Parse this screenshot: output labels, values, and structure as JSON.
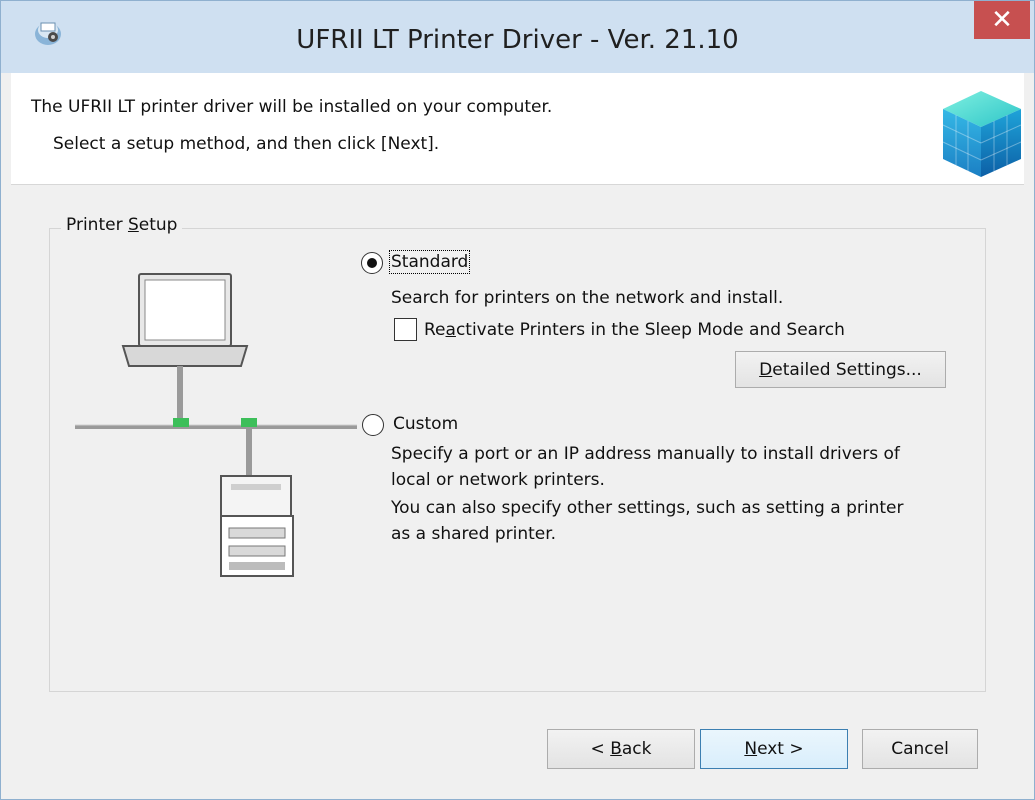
{
  "window": {
    "title": "UFRII LT Printer Driver - Ver. 21.10",
    "close_symbol": "✕",
    "app_icon": "printer-install-icon"
  },
  "header": {
    "line1": "The UFRII LT printer driver will be installed on your computer.",
    "line2": "Select a setup method, and then click [Next].",
    "graphic": "blue-cube-graphic"
  },
  "group": {
    "label_prefix": "Printer ",
    "label_accel": "S",
    "label_suffix": "etup"
  },
  "options": {
    "standard": {
      "label": "Standard",
      "accel": "S",
      "selected": true,
      "description": "Search for printers on the network and install.",
      "checkbox": {
        "label_prefix": "Re",
        "label_accel": "a",
        "label_suffix": "ctivate Printers in the Sleep Mode and Search",
        "checked": false
      },
      "settings_button": {
        "accel": "D",
        "label_rest": "etailed Settings..."
      }
    },
    "custom": {
      "label": "Custom",
      "selected": false,
      "description_line1": "Specify a port or an IP address manually to install drivers of",
      "description_line2": "local or network printers.",
      "description_line3": "You can also specify other settings, such as setting a printer",
      "description_line4": "as a shared printer."
    }
  },
  "buttons": {
    "back": {
      "prefix": "< ",
      "accel": "B",
      "rest": "ack"
    },
    "next": {
      "accel": "N",
      "rest": "ext >"
    },
    "cancel": {
      "label": "Cancel"
    }
  },
  "colors": {
    "title_bar": "#cfe0f1",
    "close_button": "#c75050",
    "network_accent": "#3dbf5a"
  }
}
